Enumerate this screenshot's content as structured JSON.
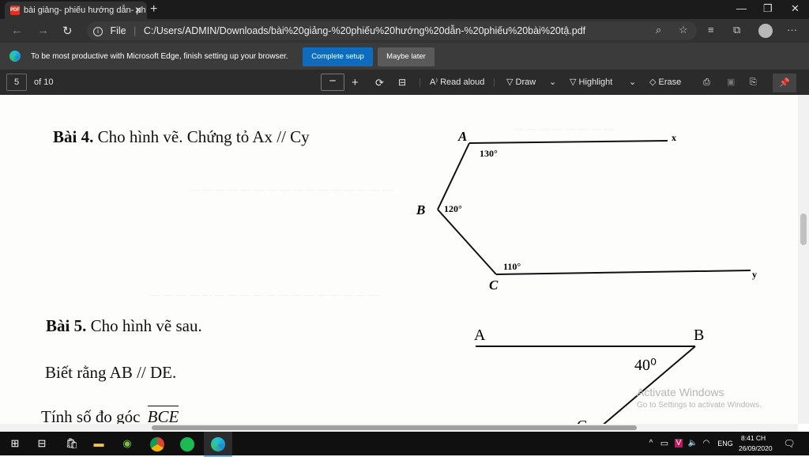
{
  "tab": {
    "title": "bài giảng- phiếu hướng dẫn- ph",
    "pdf_badge": "PDF",
    "close": "✕",
    "new": "+"
  },
  "window": {
    "minimize": "—",
    "restore": "❐",
    "close": "✕"
  },
  "address": {
    "scheme": "File",
    "url": "C:/Users/ADMIN/Downloads/bài%20giảng-%20phiếu%20hướng%20dẫn-%20phiếu%20bài%20tậ.pdf"
  },
  "infobar": {
    "message": "To be most productive with Microsoft Edge, finish setting up your browser.",
    "primary": "Complete setup",
    "secondary": "Maybe later"
  },
  "pdf_toolbar": {
    "page": "5",
    "of": "of 10",
    "read_aloud": "Read aloud",
    "draw": "Draw",
    "highlight": "Highlight",
    "erase": "Erase"
  },
  "doc": {
    "bai4": {
      "label": "Bài 4.",
      "text": "Cho hình vẽ. Chứng tỏ Ax // Cy"
    },
    "fig1": {
      "A": "A",
      "B": "B",
      "C": "C",
      "x": "x",
      "y": "y",
      "angleA": "130°",
      "angleB": "120°",
      "angleC": "110°"
    },
    "bai5": {
      "label": "Bài 5.",
      "text": "Cho hình vẽ sau."
    },
    "line2": "Biết rằng AB // DE.",
    "line3": "Tính số đo góc",
    "line3_angle": "BCE",
    "fig2": {
      "A": "A",
      "B": "B",
      "C": "C",
      "angleB": "40⁰"
    }
  },
  "watermark": {
    "title": "Activate Windows",
    "sub": "Go to Settings to activate Windows."
  },
  "taskbar": {
    "lang": "ENG",
    "time": "8:41 CH",
    "date": "26/09/2020"
  },
  "colors": {
    "edge_blue": "#0f6cbd",
    "chrome_dark": "#323232",
    "taskbar": "#101010"
  }
}
